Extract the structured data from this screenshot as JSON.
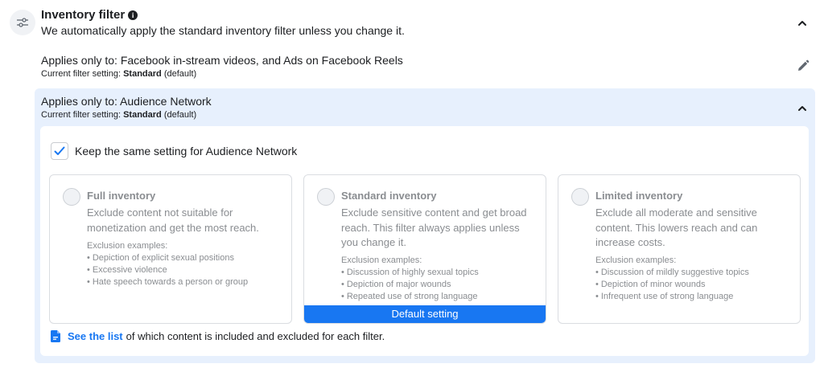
{
  "header": {
    "title": "Inventory filter",
    "description": "We automatically apply the standard inventory filter unless you change it."
  },
  "facebook_row": {
    "title": "Applies only to: Facebook in-stream videos, and Ads on Facebook Reels",
    "sub_prefix": "Current filter setting: ",
    "sub_value": "Standard",
    "sub_suffix": " (default)"
  },
  "audience_panel": {
    "title": "Applies only to: Audience Network",
    "sub_prefix": "Current filter setting: ",
    "sub_value": "Standard",
    "sub_suffix": " (default)",
    "checkbox_label": "Keep the same setting for Audience Network",
    "checkbox_checked": true
  },
  "cards": [
    {
      "title": "Full inventory",
      "description": "Exclude content not suitable for monetization and get the most reach.",
      "examples_label": "Exclusion examples:",
      "examples": [
        "Depiction of explicit sexual positions",
        "Excessive violence",
        "Hate speech towards a person or group"
      ]
    },
    {
      "title": "Standard inventory",
      "description": "Exclude sensitive content and get broad reach. This filter always applies unless you change it.",
      "examples_label": "Exclusion examples:",
      "examples": [
        "Discussion of highly sexual topics",
        "Depiction of major wounds",
        "Repeated use of strong language"
      ],
      "badge": "Default setting"
    },
    {
      "title": "Limited inventory",
      "description": "Exclude all moderate and sensitive content. This lowers reach and can increase costs.",
      "examples_label": "Exclusion examples:",
      "examples": [
        "Discussion of mildly suggestive topics",
        "Depiction of minor wounds",
        "Infrequent use of strong language"
      ]
    }
  ],
  "footer": {
    "link_text": "See the list",
    "rest_text": "of which content is included and excluded for each filter."
  },
  "colors": {
    "accent": "#1877f2",
    "panel_bg": "#e7f0fd",
    "muted_text": "#8a8d91"
  },
  "icons": {
    "filter": "sliders-icon",
    "info": "info-icon",
    "collapse": "chevron-up-icon",
    "edit": "pencil-icon",
    "checkbox": "checkmark-icon",
    "doc": "document-icon"
  }
}
